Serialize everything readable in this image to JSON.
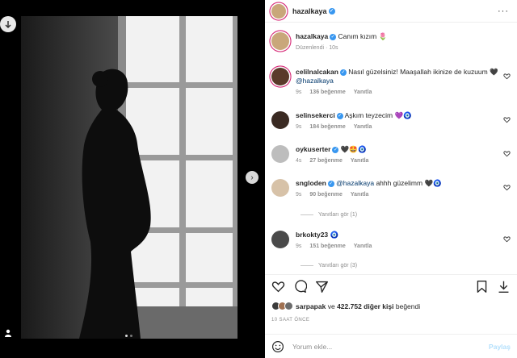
{
  "post": {
    "author": "hazalkaya",
    "caption": "Canım kızım",
    "caption_emoji": "🌷",
    "edited": "Düzenlendi · 10s"
  },
  "comments": [
    {
      "user": "celilnalcakan",
      "text": "Nasıl güzelsiniz! Maaşallah ikinize de kuzuum",
      "emoji": "🖤",
      "mention": "@hazalkaya",
      "time": "9s",
      "likes": "136 beğenme",
      "reply": "Yanıtla"
    },
    {
      "user": "selinsekerci",
      "text": "Aşkım teyzecim",
      "emoji": "💜🧿",
      "time": "9s",
      "likes": "184 beğenme",
      "reply": "Yanıtla"
    },
    {
      "user": "oykuserter",
      "text": "",
      "emoji": "🖤🤩🧿",
      "time": "4s",
      "likes": "27 beğenme",
      "reply": "Yanıtla"
    },
    {
      "user": "sngloden",
      "mention": "@hazalkaya",
      "text": "ahhh güzelimm",
      "emoji": "🖤🧿",
      "time": "9s",
      "likes": "90 beğenme",
      "reply": "Yanıtla",
      "view_replies": "Yanıtları gör (1)"
    },
    {
      "user": "brkokty23",
      "text": "",
      "emoji": "🧿",
      "time": "9s",
      "likes": "151 beğenme",
      "reply": "Yanıtla",
      "view_replies": "Yanıtları gör (3)"
    }
  ],
  "likes": {
    "first_user": "sarpapak",
    "connector": "ve",
    "others": "422.752 diğer kişi",
    "suffix": "beğendi"
  },
  "timestamp": "10 SAAT ÖNCE",
  "comment_box": {
    "placeholder": "Yorum ekle...",
    "share_label": "Paylaş"
  },
  "icons": {
    "header_more": "more-dots-icon",
    "like": "heart-icon",
    "comment": "comment-icon",
    "share": "send-icon",
    "save": "bookmark-icon",
    "emoji": "emoji-smiley-icon"
  },
  "colors": {
    "verified": "#3897f0",
    "mention": "#00376b",
    "muted": "#8e8e8e",
    "share_disabled": "#b2dffc"
  }
}
